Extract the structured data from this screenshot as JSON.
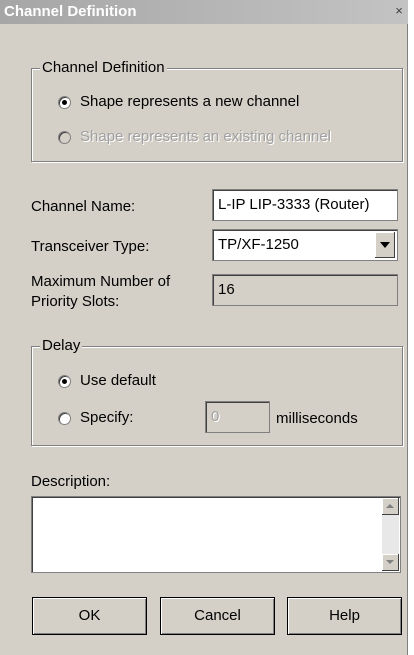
{
  "window": {
    "title": "Channel Definition",
    "close_glyph": "×"
  },
  "channel_definition_group": {
    "legend": "Channel Definition",
    "option_new": "Shape represents a new channel",
    "option_existing": "Shape represents an existing channel",
    "selected": "new",
    "existing_enabled": false
  },
  "channel_name": {
    "label": "Channel Name:",
    "value": "L-IP LIP-3333 (Router)"
  },
  "transceiver": {
    "label": "Transceiver Type:",
    "value": "TP/XF-1250"
  },
  "priority_slots": {
    "label_line1": "Maximum  Number of",
    "label_line2": "Priority Slots:",
    "value": "16"
  },
  "delay_group": {
    "legend": "Delay",
    "option_default": "Use default",
    "option_specify": "Specify:",
    "selected": "default",
    "specify_value": "0",
    "unit": "milliseconds"
  },
  "description": {
    "label": "Description:",
    "value": ""
  },
  "buttons": {
    "ok": "OK",
    "cancel": "Cancel",
    "help": "Help"
  },
  "colors": {
    "dialog_bg": "#d4d0c8",
    "titlebar": "#b0b0b0",
    "disabled_text": "#a0a0a0"
  }
}
